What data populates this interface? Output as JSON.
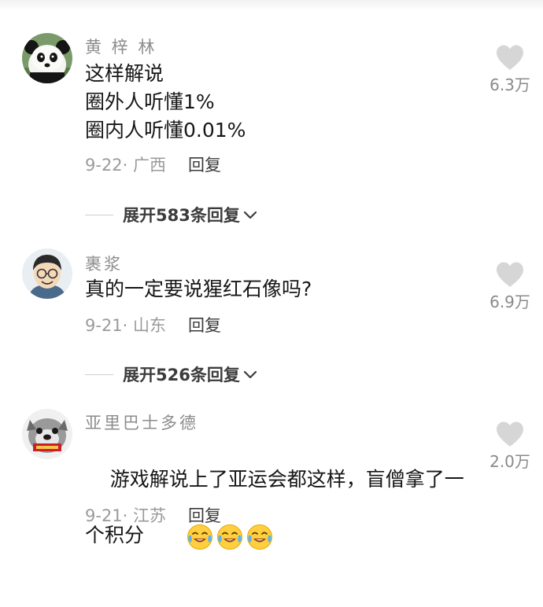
{
  "comments": [
    {
      "username": "黄 梓 林",
      "text": "这样解说\n圈外人听懂1%\n圈内人听懂0.01%",
      "date_location": "9-22· 广西",
      "reply_label": "回复",
      "likes": "6.3万",
      "avatar": "panda-avatar",
      "expand_label": "展开583条回复"
    },
    {
      "username": "裹浆",
      "text": "真的一定要说猩红石像吗?",
      "date_location": "9-21· 山东",
      "reply_label": "回复",
      "likes": "6.9万",
      "avatar": "cartoon-man-avatar",
      "expand_label": "展开526条回复"
    },
    {
      "username": "亚里巴士多德",
      "text": "游戏解说上了亚运会都这样，盲僧拿了一个积分",
      "emojis": [
        "laugh-cry-emoji",
        "laugh-cry-emoji",
        "laugh-cry-emoji"
      ],
      "date_location": "9-21· 江苏",
      "reply_label": "回复",
      "likes": "2.0万",
      "avatar": "dog-avatar"
    }
  ],
  "icons": {
    "like": "heart-icon",
    "expand": "chevron-down-icon"
  },
  "colors": {
    "username": "#8c8c8c",
    "body_text": "#161616",
    "meta": "#9a9a9a",
    "heart": "#d6d6d6",
    "expand": "#3c3c3c"
  }
}
